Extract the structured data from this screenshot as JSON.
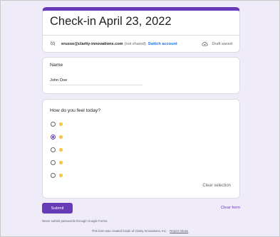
{
  "form": {
    "title": "Check-in April 23, 2022",
    "accent": "#673ab7"
  },
  "account": {
    "email": "erusso@clarity-innovations.com",
    "note": "(not shared)",
    "switch_label": "Switch account",
    "status": "Draft saved",
    "icons": {
      "not_shared": "eye-off-icon",
      "cloud": "cloud-done-icon"
    }
  },
  "name_question": {
    "label": "Name",
    "value": "John Doe"
  },
  "feel_question": {
    "label": "How do you feel today?",
    "options": [
      {
        "emoji": "smiley-emoji",
        "checked": false
      },
      {
        "emoji": "smiley-emoji",
        "checked": true
      },
      {
        "emoji": "smiley-emoji",
        "checked": false
      },
      {
        "emoji": "smiley-emoji",
        "checked": false
      },
      {
        "emoji": "smiley-emoji",
        "checked": false
      }
    ],
    "clear_label": "Clear selection"
  },
  "actions": {
    "submit_label": "Submit",
    "clear_form_label": "Clear form"
  },
  "footer": {
    "notice": "Never submit passwords through Google Forms.",
    "created_text": "This form was created inside of Clarity Innovations, Inc.",
    "report_label": "Report Abuse"
  }
}
